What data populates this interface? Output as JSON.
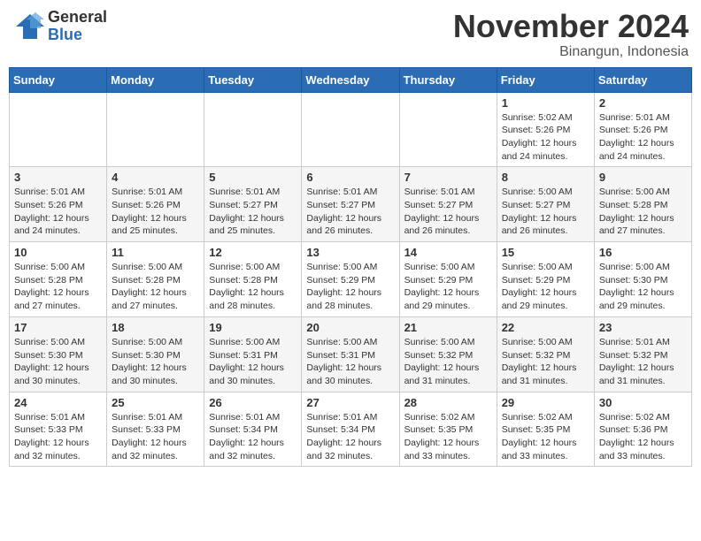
{
  "header": {
    "logo_general": "General",
    "logo_blue": "Blue",
    "month": "November 2024",
    "location": "Binangun, Indonesia"
  },
  "weekdays": [
    "Sunday",
    "Monday",
    "Tuesday",
    "Wednesday",
    "Thursday",
    "Friday",
    "Saturday"
  ],
  "weeks": [
    [
      {
        "day": "",
        "info": ""
      },
      {
        "day": "",
        "info": ""
      },
      {
        "day": "",
        "info": ""
      },
      {
        "day": "",
        "info": ""
      },
      {
        "day": "",
        "info": ""
      },
      {
        "day": "1",
        "info": "Sunrise: 5:02 AM\nSunset: 5:26 PM\nDaylight: 12 hours\nand 24 minutes."
      },
      {
        "day": "2",
        "info": "Sunrise: 5:01 AM\nSunset: 5:26 PM\nDaylight: 12 hours\nand 24 minutes."
      }
    ],
    [
      {
        "day": "3",
        "info": "Sunrise: 5:01 AM\nSunset: 5:26 PM\nDaylight: 12 hours\nand 24 minutes."
      },
      {
        "day": "4",
        "info": "Sunrise: 5:01 AM\nSunset: 5:26 PM\nDaylight: 12 hours\nand 25 minutes."
      },
      {
        "day": "5",
        "info": "Sunrise: 5:01 AM\nSunset: 5:27 PM\nDaylight: 12 hours\nand 25 minutes."
      },
      {
        "day": "6",
        "info": "Sunrise: 5:01 AM\nSunset: 5:27 PM\nDaylight: 12 hours\nand 26 minutes."
      },
      {
        "day": "7",
        "info": "Sunrise: 5:01 AM\nSunset: 5:27 PM\nDaylight: 12 hours\nand 26 minutes."
      },
      {
        "day": "8",
        "info": "Sunrise: 5:00 AM\nSunset: 5:27 PM\nDaylight: 12 hours\nand 26 minutes."
      },
      {
        "day": "9",
        "info": "Sunrise: 5:00 AM\nSunset: 5:28 PM\nDaylight: 12 hours\nand 27 minutes."
      }
    ],
    [
      {
        "day": "10",
        "info": "Sunrise: 5:00 AM\nSunset: 5:28 PM\nDaylight: 12 hours\nand 27 minutes."
      },
      {
        "day": "11",
        "info": "Sunrise: 5:00 AM\nSunset: 5:28 PM\nDaylight: 12 hours\nand 27 minutes."
      },
      {
        "day": "12",
        "info": "Sunrise: 5:00 AM\nSunset: 5:28 PM\nDaylight: 12 hours\nand 28 minutes."
      },
      {
        "day": "13",
        "info": "Sunrise: 5:00 AM\nSunset: 5:29 PM\nDaylight: 12 hours\nand 28 minutes."
      },
      {
        "day": "14",
        "info": "Sunrise: 5:00 AM\nSunset: 5:29 PM\nDaylight: 12 hours\nand 29 minutes."
      },
      {
        "day": "15",
        "info": "Sunrise: 5:00 AM\nSunset: 5:29 PM\nDaylight: 12 hours\nand 29 minutes."
      },
      {
        "day": "16",
        "info": "Sunrise: 5:00 AM\nSunset: 5:30 PM\nDaylight: 12 hours\nand 29 minutes."
      }
    ],
    [
      {
        "day": "17",
        "info": "Sunrise: 5:00 AM\nSunset: 5:30 PM\nDaylight: 12 hours\nand 30 minutes."
      },
      {
        "day": "18",
        "info": "Sunrise: 5:00 AM\nSunset: 5:30 PM\nDaylight: 12 hours\nand 30 minutes."
      },
      {
        "day": "19",
        "info": "Sunrise: 5:00 AM\nSunset: 5:31 PM\nDaylight: 12 hours\nand 30 minutes."
      },
      {
        "day": "20",
        "info": "Sunrise: 5:00 AM\nSunset: 5:31 PM\nDaylight: 12 hours\nand 30 minutes."
      },
      {
        "day": "21",
        "info": "Sunrise: 5:00 AM\nSunset: 5:32 PM\nDaylight: 12 hours\nand 31 minutes."
      },
      {
        "day": "22",
        "info": "Sunrise: 5:00 AM\nSunset: 5:32 PM\nDaylight: 12 hours\nand 31 minutes."
      },
      {
        "day": "23",
        "info": "Sunrise: 5:01 AM\nSunset: 5:32 PM\nDaylight: 12 hours\nand 31 minutes."
      }
    ],
    [
      {
        "day": "24",
        "info": "Sunrise: 5:01 AM\nSunset: 5:33 PM\nDaylight: 12 hours\nand 32 minutes."
      },
      {
        "day": "25",
        "info": "Sunrise: 5:01 AM\nSunset: 5:33 PM\nDaylight: 12 hours\nand 32 minutes."
      },
      {
        "day": "26",
        "info": "Sunrise: 5:01 AM\nSunset: 5:34 PM\nDaylight: 12 hours\nand 32 minutes."
      },
      {
        "day": "27",
        "info": "Sunrise: 5:01 AM\nSunset: 5:34 PM\nDaylight: 12 hours\nand 32 minutes."
      },
      {
        "day": "28",
        "info": "Sunrise: 5:02 AM\nSunset: 5:35 PM\nDaylight: 12 hours\nand 33 minutes."
      },
      {
        "day": "29",
        "info": "Sunrise: 5:02 AM\nSunset: 5:35 PM\nDaylight: 12 hours\nand 33 minutes."
      },
      {
        "day": "30",
        "info": "Sunrise: 5:02 AM\nSunset: 5:36 PM\nDaylight: 12 hours\nand 33 minutes."
      }
    ]
  ]
}
